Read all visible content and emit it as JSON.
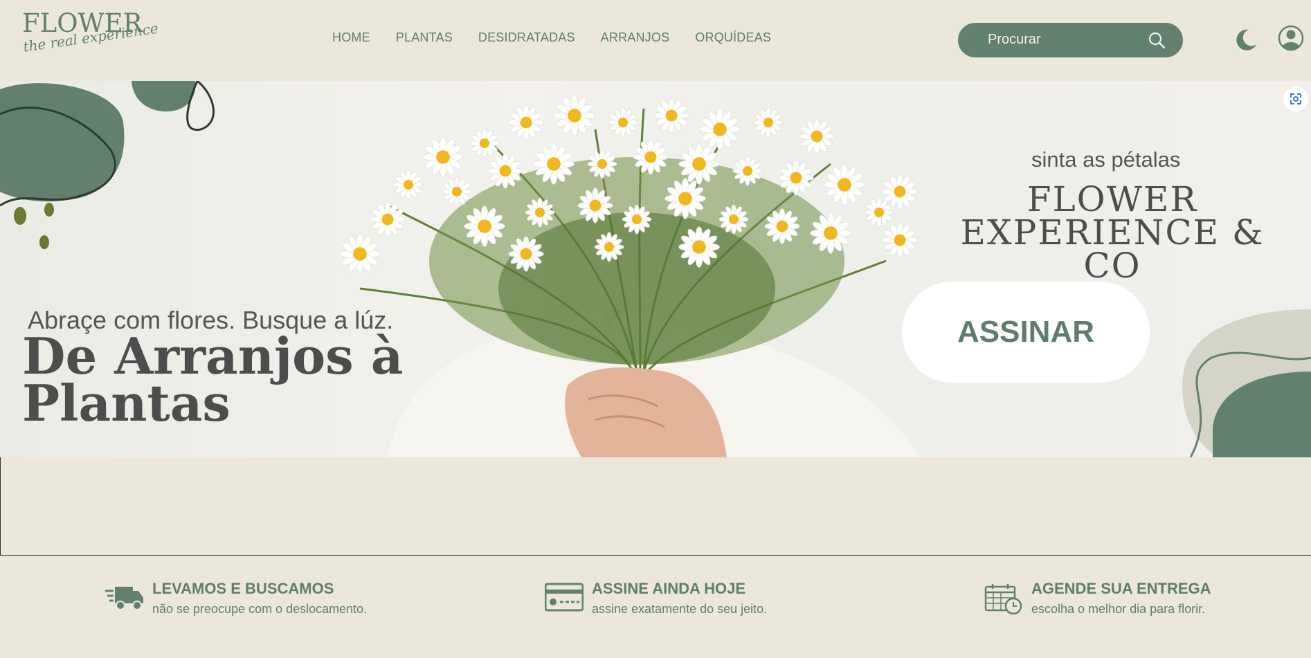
{
  "header": {
    "logo_word": "FLOWER",
    "logo_tagline": "the real experience",
    "nav": [
      "HOME",
      "PLANTAS",
      "DESIDRATADAS",
      "ARRANJOS",
      "ORQUÍDEAS"
    ],
    "search_placeholder": "Procurar"
  },
  "hero": {
    "subtitle": "Abraçe com flores. Busque a lúz.",
    "title_line1": "De Arranjos à",
    "title_line2": "Plantas",
    "tagline": "sinta as pétalas",
    "brand_line1": "FLOWER",
    "brand_line2": "EXPERIENCE & CO",
    "cta": "ASSINAR"
  },
  "features": [
    {
      "icon": "truck-icon",
      "title": "LEVAMOS E BUSCAMOS",
      "desc": "não se preocupe com o deslocamento."
    },
    {
      "icon": "credit-card-icon",
      "title": "ASSINE AINDA HOJE",
      "desc": "assine exatamente do seu jeito."
    },
    {
      "icon": "calendar-clock-icon",
      "title": "AGENDE SUA ENTREGA",
      "desc": "escolha o melhor dia para florir."
    }
  ],
  "colors": {
    "background": "#ebe7da",
    "accent_green": "#63806f",
    "text_dark": "#4d4d4d"
  }
}
